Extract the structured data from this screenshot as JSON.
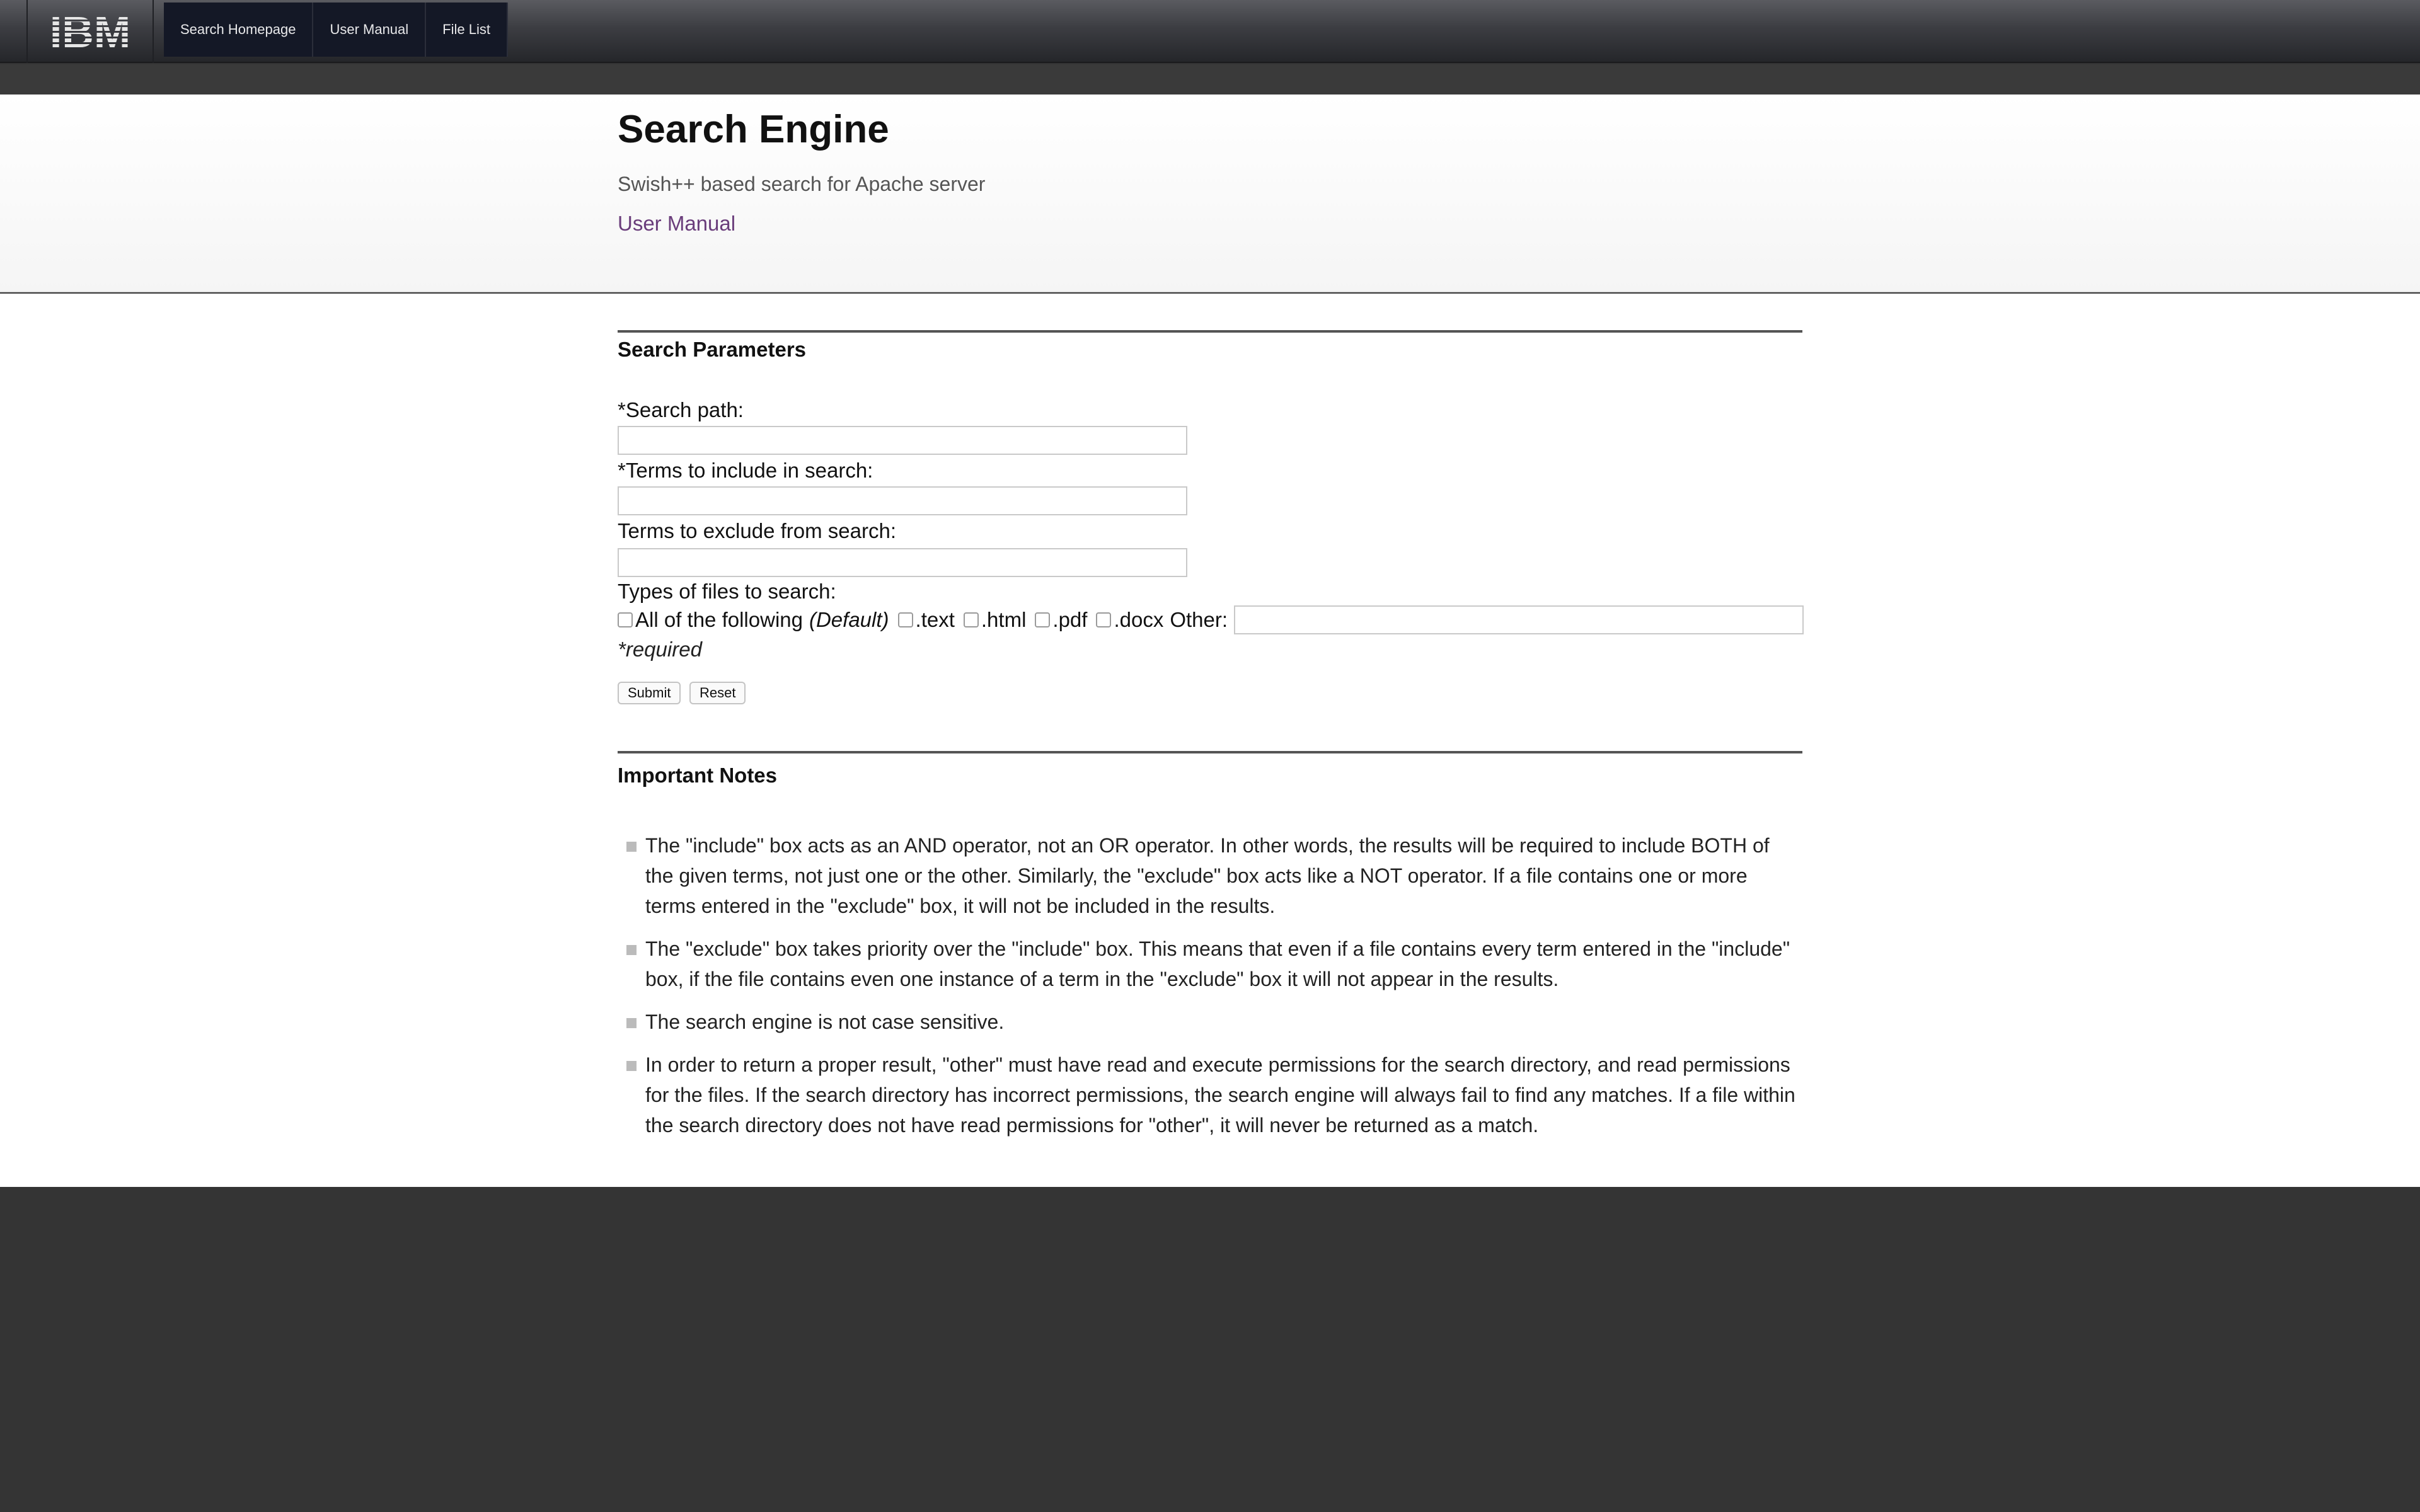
{
  "nav": {
    "logo": "IBM",
    "items": [
      {
        "label": "Search Homepage"
      },
      {
        "label": "User Manual"
      },
      {
        "label": "File List"
      }
    ]
  },
  "header": {
    "title": "Search Engine",
    "subtitle": "Swish++ based search for Apache server",
    "manual_link": "User Manual"
  },
  "form": {
    "section_title": "Search Parameters",
    "search_path_label": "*Search path:",
    "search_path_value": "",
    "include_label": "*Terms to include in search:",
    "include_value": "",
    "exclude_label": "Terms to exclude from search:",
    "exclude_value": "",
    "types_label": "Types of files to search:",
    "types": {
      "all_label": "All of the following",
      "all_default": "(Default)",
      "text": ".text",
      "html": ".html",
      "pdf": ".pdf",
      "docx": ".docx",
      "other_label": "Other:",
      "other_value": ""
    },
    "required_note": "*required",
    "submit_label": "Submit",
    "reset_label": "Reset"
  },
  "notes": {
    "section_title": "Important Notes",
    "items": [
      "The \"include\" box acts as an AND operator, not an OR operator. In other words, the results will be required to include BOTH of the given terms, not just one or the other. Similarly, the \"exclude\" box acts like a NOT operator. If a file contains one or more terms entered in the \"exclude\" box, it will not be included in the results.",
      "The \"exclude\" box takes priority over the \"include\" box. This means that even if a file contains every term entered in the \"include\" box, if the file contains even one instance of a term in the \"exclude\" box it will not appear in the results.",
      "The search engine is not case sensitive.",
      "In order to return a proper result, \"other\" must have read and execute permissions for the search directory, and read permissions for the files. If the search directory has incorrect permissions, the search engine will always fail to find any matches. If a file within the search directory does not have read permissions for \"other\", it will never be returned as a match."
    ]
  },
  "colors": {
    "topbar": "#3c3d42",
    "nav_item_bg": "#141826",
    "link": "#6a3d7b",
    "footer_bg": "#343434"
  }
}
